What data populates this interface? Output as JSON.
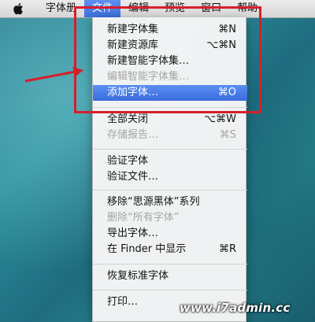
{
  "menubar": {
    "apple_icon": "apple-icon",
    "items": [
      {
        "label": "字体册"
      },
      {
        "label": "文件"
      },
      {
        "label": "编辑"
      },
      {
        "label": "预览"
      },
      {
        "label": "窗口"
      },
      {
        "label": "帮助"
      }
    ]
  },
  "file_menu": {
    "items": [
      {
        "label": "新建字体集",
        "shortcut": "⌘N"
      },
      {
        "label": "新建资源库",
        "shortcut": "⌥⌘N"
      },
      {
        "label": "新建智能字体集…",
        "shortcut": ""
      },
      {
        "label": "编辑智能字体集…",
        "shortcut": ""
      },
      {
        "label": "添加字体…",
        "shortcut": "⌘O"
      },
      {
        "label": "全部关闭",
        "shortcut": "⌥⌘W"
      },
      {
        "label": "存储报告…",
        "shortcut": "⌘S"
      },
      {
        "label": "验证字体",
        "shortcut": ""
      },
      {
        "label": "验证文件…",
        "shortcut": ""
      },
      {
        "label": "移除“思源黑体”系列",
        "shortcut": ""
      },
      {
        "label": "删除“所有字体”",
        "shortcut": ""
      },
      {
        "label": "导出字体…",
        "shortcut": ""
      },
      {
        "label": "在 Finder 中显示",
        "shortcut": "⌘R"
      },
      {
        "label": "恢复标准字体",
        "shortcut": ""
      },
      {
        "label": "打印…",
        "shortcut": ""
      }
    ]
  },
  "annotation": {
    "box_color": "#d61f2b",
    "arrow_color": "#d61f2b"
  },
  "watermark": {
    "text": "www.i7admin.cc"
  },
  "colors": {
    "highlight": "#3a6cdc",
    "disabled_text": "#a5a5a5"
  }
}
